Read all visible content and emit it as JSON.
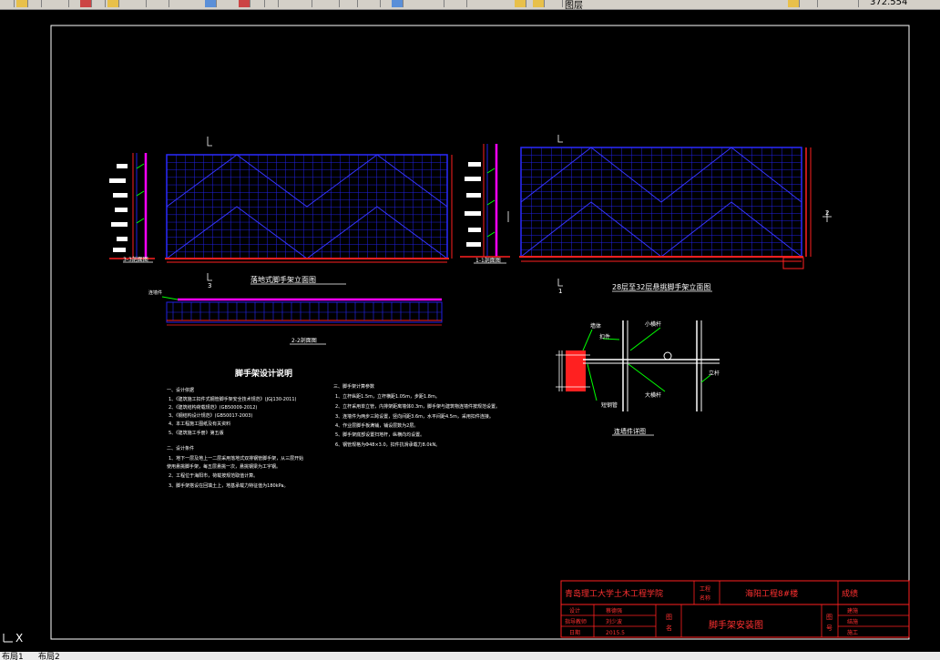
{
  "toolbar": {
    "layer_label": "图层",
    "coord_label": "372.554"
  },
  "drawing": {
    "elev1_title": "落地式脚手架立面图",
    "elev2_title": "28层至32层悬挑脚手架立面图",
    "sec_11": "1-1剖面图",
    "sec_22": "2-2剖面图",
    "sec_33": "3-3剖面图",
    "plan_tag": "连墙件",
    "mark_1": "1",
    "mark_2": "2",
    "mark_3": "3",
    "detail": {
      "title": "连墙件详图",
      "labels": [
        "墙体",
        "扣件",
        "小横杆",
        "大横杆",
        "立杆",
        "短钢管"
      ]
    },
    "notes": {
      "title": "脚手架设计说明",
      "left": [
        "一、设计依据",
        "1、《建筑施工扣件式钢管脚手架安全技术规范》(JGJ130-2011)",
        "2、《建筑结构荷载规范》(GB50009-2012)",
        "3、《钢结构设计规范》(GB50017-2003)",
        "4、本工程施工图纸及有关资料",
        "5、《建筑施工手册》第五版",
        "二、设计条件",
        "1、地下一层及地上一二层采用落地式双排钢管脚手架，从三层开始",
        "使用悬挑脚手架，每五层悬挑一次，悬挑钢梁为工字钢。",
        "2、工程位于海阳市，荷载按规范取值计算。",
        "3、脚手架搭设在回填土上，地基承载力特征值为180kPa。"
      ],
      "right": [
        "三、脚手架计算参数",
        "1、立杆纵距1.5m，立杆横距1.05m，步距1.8m。",
        "2、立杆采用单立管，内排架距离墙体0.3m，脚手架与建筑物连墙件按规范设置。",
        "3、连墙件为两步三跨设置，竖向间距3.6m，水平间距4.5m，采用扣件连接。",
        "4、作业层脚手板满铺，铺设层数为2层。",
        "5、脚手架底部设置扫地杆，纵横向均设置。",
        "6、钢管规格为Φ48×3.0，扣件抗滑承载力8.0kN。"
      ]
    },
    "titleblock": {
      "school": "青岛理工大学土木工程学院",
      "project_label_1": "工程",
      "project_label_2": "名称",
      "project_name": "海阳工程8#楼",
      "grade_label": "成绩",
      "design_label": "设计",
      "designer": "蔡德强",
      "advisor_label": "指导教师",
      "advisor": "刘少波",
      "date_label": "日期",
      "date": "2015.5",
      "figname_label_1": "图",
      "figname_label_2": "名",
      "drawing_name": "脚手架安装图",
      "fignum_label_1": "图",
      "fignum_label_2": "号",
      "major_label": "建施",
      "check_label": "结施",
      "num_label": "施工"
    }
  },
  "status": {
    "x_mark": "X",
    "tab1": "布局1",
    "tab2": "布局2"
  }
}
